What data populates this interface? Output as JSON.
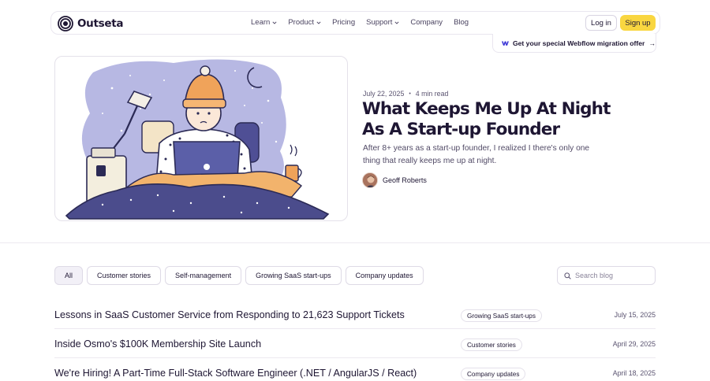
{
  "header": {
    "brand": "Outseta",
    "nav": [
      {
        "label": "Learn",
        "dropdown": true
      },
      {
        "label": "Product",
        "dropdown": true
      },
      {
        "label": "Pricing",
        "dropdown": false
      },
      {
        "label": "Support",
        "dropdown": true
      },
      {
        "label": "Company",
        "dropdown": false
      },
      {
        "label": "Blog",
        "dropdown": false
      }
    ],
    "login_label": "Log in",
    "signup_label": "Sign up"
  },
  "promo": {
    "text": "Get your special Webflow migration offer",
    "arrow": "→",
    "icon": "webflow-icon"
  },
  "featured": {
    "date": "July 22, 2025",
    "separator": "•",
    "read_time": "4 min read",
    "title": "What Keeps Me Up At Night As A Start-up Founder",
    "excerpt": "After 8+ years as a start-up founder, I realized I there's only one thing that really keeps me up at night.",
    "author": "Geoff Roberts"
  },
  "filters": {
    "chips": [
      "All",
      "Customer stories",
      "Self-management",
      "Growing SaaS start-ups",
      "Company updates"
    ],
    "active": "All",
    "search_placeholder": "Search blog"
  },
  "posts": [
    {
      "title": "Lessons in SaaS Customer Service from Responding to 21,623 Support Tickets",
      "tag": "Growing SaaS start-ups",
      "date": "July 15, 2025"
    },
    {
      "title": "Inside Osmo's $100K Membership Site Launch",
      "tag": "Customer stories",
      "date": "April 29, 2025"
    },
    {
      "title": "We're Hiring! A Part-Time Full-Stack Software Engineer (.NET / AngularJS / React)",
      "tag": "Company updates",
      "date": "April 18, 2025"
    }
  ],
  "colors": {
    "accent": "#f9d640",
    "text": "#1e1633",
    "illustration_blue": "#5b5fa8",
    "illustration_orange": "#f0a35a"
  }
}
